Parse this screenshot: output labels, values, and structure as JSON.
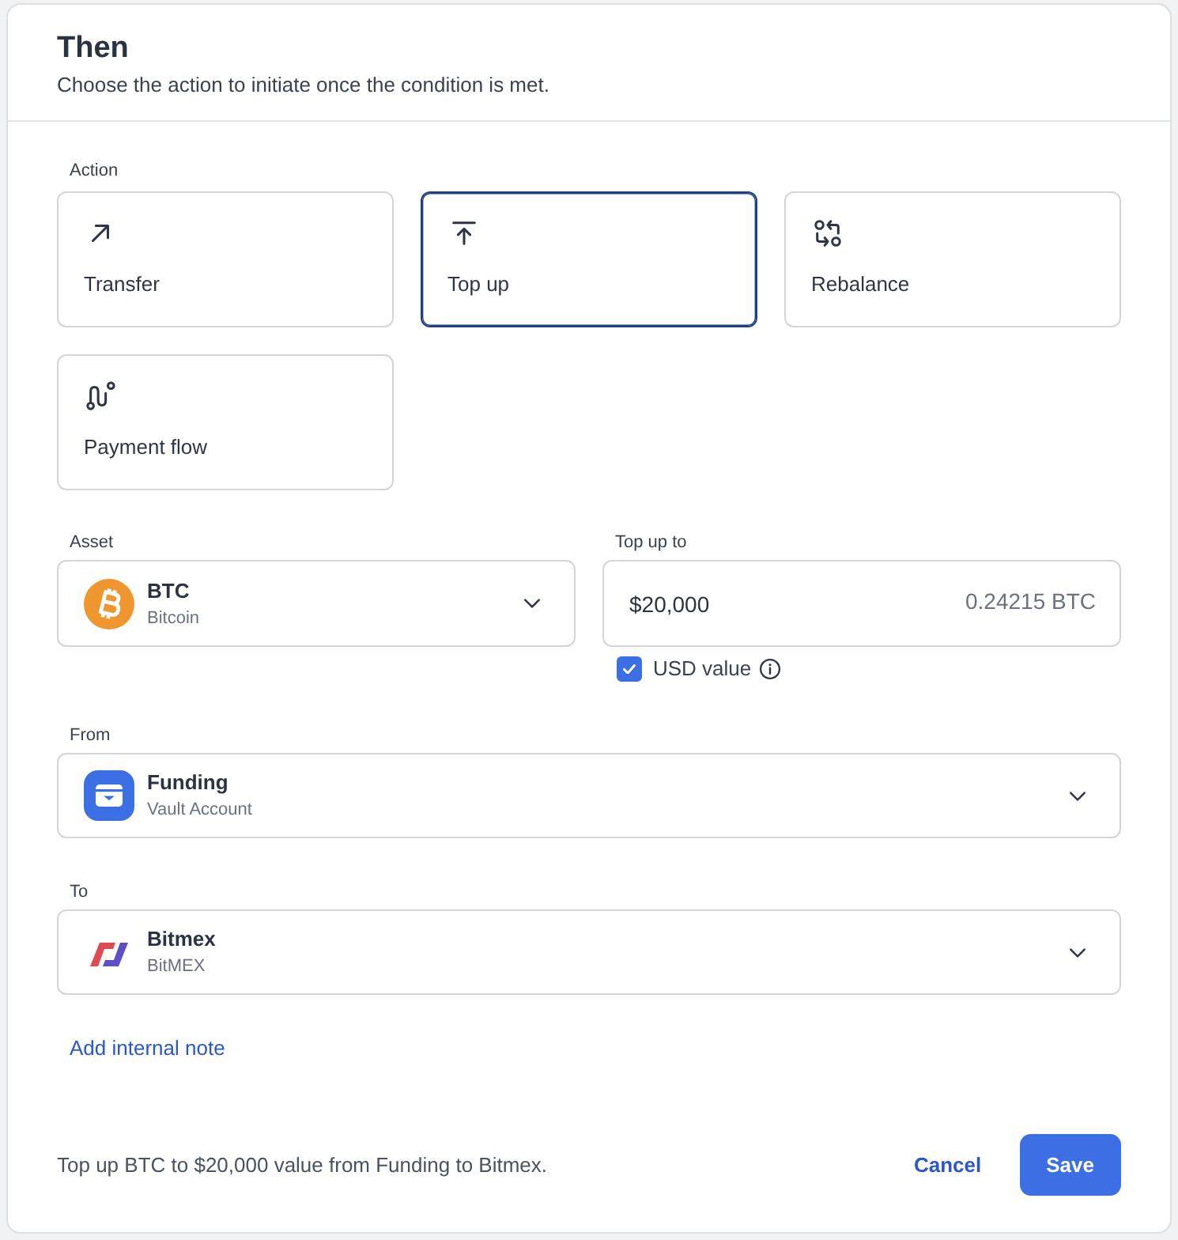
{
  "header": {
    "title": "Then",
    "subtitle": "Choose the action to initiate once the condition is met."
  },
  "action": {
    "label": "Action",
    "options": [
      {
        "label": "Transfer",
        "selected": false
      },
      {
        "label": "Top up",
        "selected": true
      },
      {
        "label": "Rebalance",
        "selected": false
      },
      {
        "label": "Payment flow",
        "selected": false
      }
    ]
  },
  "asset": {
    "label": "Asset",
    "title": "BTC",
    "subtitle": "Bitcoin"
  },
  "top_up": {
    "label": "Top up to",
    "value": "$20,000",
    "conversion": "0.24215 BTC",
    "usd_value": {
      "label": "USD value",
      "checked": true
    }
  },
  "from": {
    "label": "From",
    "title": "Funding",
    "subtitle": "Vault Account"
  },
  "to": {
    "label": "To",
    "title": "Bitmex",
    "subtitle": "BitMEX"
  },
  "note_link": "Add internal note",
  "footer": {
    "summary": "Top up BTC to $20,000 value from Funding to Bitmex.",
    "buttons": [
      {
        "label": "Cancel",
        "kind": "secondary"
      },
      {
        "label": "Save",
        "kind": "primary"
      }
    ]
  }
}
